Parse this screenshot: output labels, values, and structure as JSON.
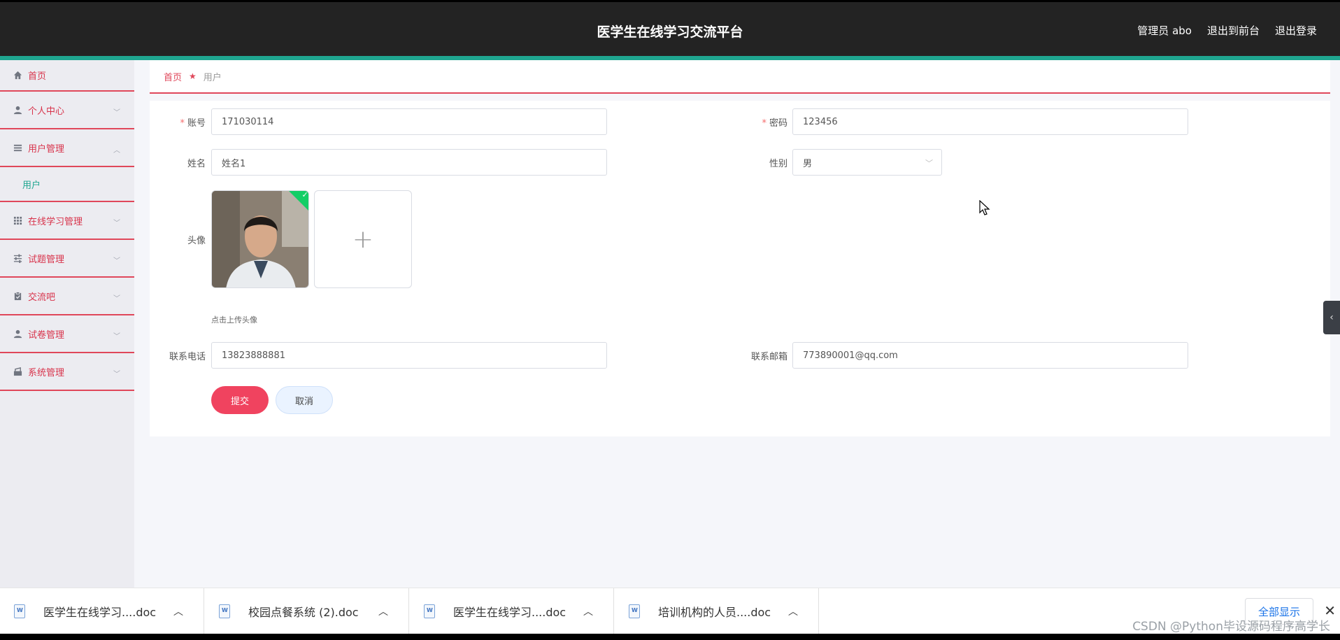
{
  "header": {
    "title": "医学生在线学习交流平台",
    "user_label": "管理员 abo",
    "to_front": "退出到前台",
    "logout": "退出登录"
  },
  "sidebar": {
    "items": [
      {
        "label": "首页",
        "icon": "home-icon"
      },
      {
        "label": "个人中心",
        "icon": "person-icon"
      },
      {
        "label": "用户管理",
        "icon": "list-icon",
        "expanded": true
      },
      {
        "label": "在线学习管理",
        "icon": "grid-icon"
      },
      {
        "label": "试题管理",
        "icon": "sliders-icon"
      },
      {
        "label": "交流吧",
        "icon": "clipboard-icon"
      },
      {
        "label": "试卷管理",
        "icon": "person-icon"
      },
      {
        "label": "系统管理",
        "icon": "settings-icon"
      }
    ],
    "sub_item": "用户"
  },
  "breadcrumb": {
    "home": "首页",
    "current": "用户"
  },
  "form": {
    "account_label": "账号",
    "account_value": "171030114",
    "password_label": "密码",
    "password_value": "123456",
    "name_label": "姓名",
    "name_value": "姓名1",
    "gender_label": "性别",
    "gender_value": "男",
    "avatar_label": "头像",
    "upload_tip": "点击上传头像",
    "phone_label": "联系电话",
    "phone_value": "13823888881",
    "email_label": "联系邮箱",
    "email_value": "773890001@qq.com",
    "submit": "提交",
    "cancel": "取消"
  },
  "downloads": {
    "items": [
      {
        "name": "医学生在线学习....doc"
      },
      {
        "name": "校园点餐系统 (2).doc"
      },
      {
        "name": "医学生在线学习....doc"
      },
      {
        "name": "培训机构的人员....doc"
      }
    ],
    "show_all": "全部显示"
  },
  "watermark": "CSDN @Python毕设源码程序高学长",
  "colors": {
    "header_bg": "#232323",
    "accent_teal": "#1fa690",
    "accent_red": "#e0475a",
    "submit_bg": "#f0435f"
  }
}
